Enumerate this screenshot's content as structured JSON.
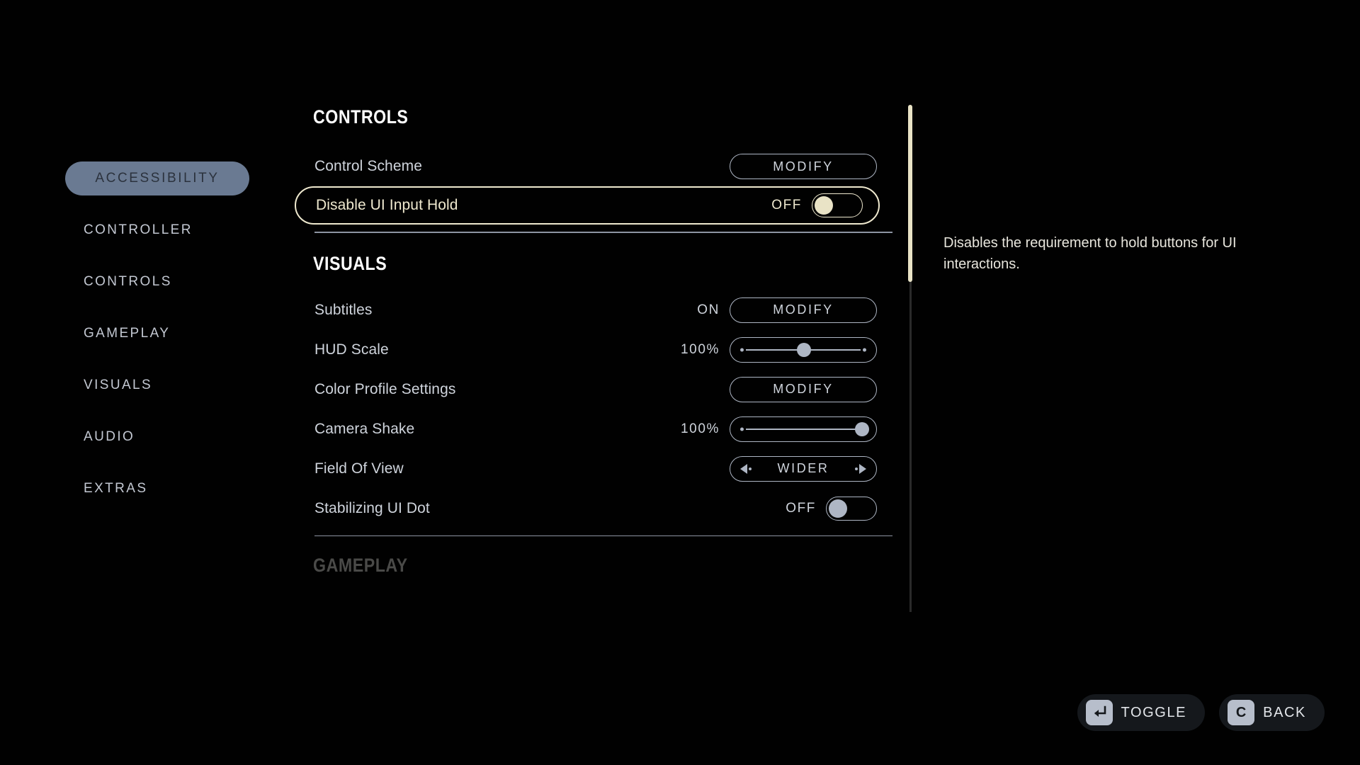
{
  "sidebar": {
    "items": [
      {
        "label": "ACCESSIBILITY",
        "active": true
      },
      {
        "label": "CONTROLLER",
        "active": false
      },
      {
        "label": "CONTROLS",
        "active": false
      },
      {
        "label": "GAMEPLAY",
        "active": false
      },
      {
        "label": "VISUALS",
        "active": false
      },
      {
        "label": "AUDIO",
        "active": false
      },
      {
        "label": "EXTRAS",
        "active": false
      }
    ]
  },
  "sections": {
    "controls": {
      "heading": "CONTROLS",
      "rows": {
        "control_scheme": {
          "label": "Control Scheme",
          "action": "MODIFY"
        },
        "disable_ui_input_hold": {
          "label": "Disable UI Input Hold",
          "value": "OFF"
        }
      }
    },
    "visuals": {
      "heading": "VISUALS",
      "rows": {
        "subtitles": {
          "label": "Subtitles",
          "value": "ON",
          "action": "MODIFY"
        },
        "hud_scale": {
          "label": "HUD Scale",
          "value": "100%",
          "knob_percent": 50
        },
        "color_profile": {
          "label": "Color Profile Settings",
          "action": "MODIFY"
        },
        "camera_shake": {
          "label": "Camera Shake",
          "value": "100%",
          "knob_percent": 100
        },
        "field_of_view": {
          "label": "Field Of View",
          "value": "WIDER"
        },
        "stabilizing_ui_dot": {
          "label": "Stabilizing UI Dot",
          "value": "OFF"
        }
      }
    },
    "gameplay": {
      "heading": "GAMEPLAY"
    }
  },
  "description": "Disables the requirement to hold buttons for UI interactions.",
  "hints": [
    {
      "key": "enter",
      "label": "TOGGLE"
    },
    {
      "key": "C",
      "label": "BACK"
    }
  ],
  "colors": {
    "background": "#010101",
    "accent_cream": "#efe9cf",
    "control_gray": "#aeb6c4",
    "active_nav": "#6a7a92",
    "text_primary": "#cfd4dc"
  }
}
